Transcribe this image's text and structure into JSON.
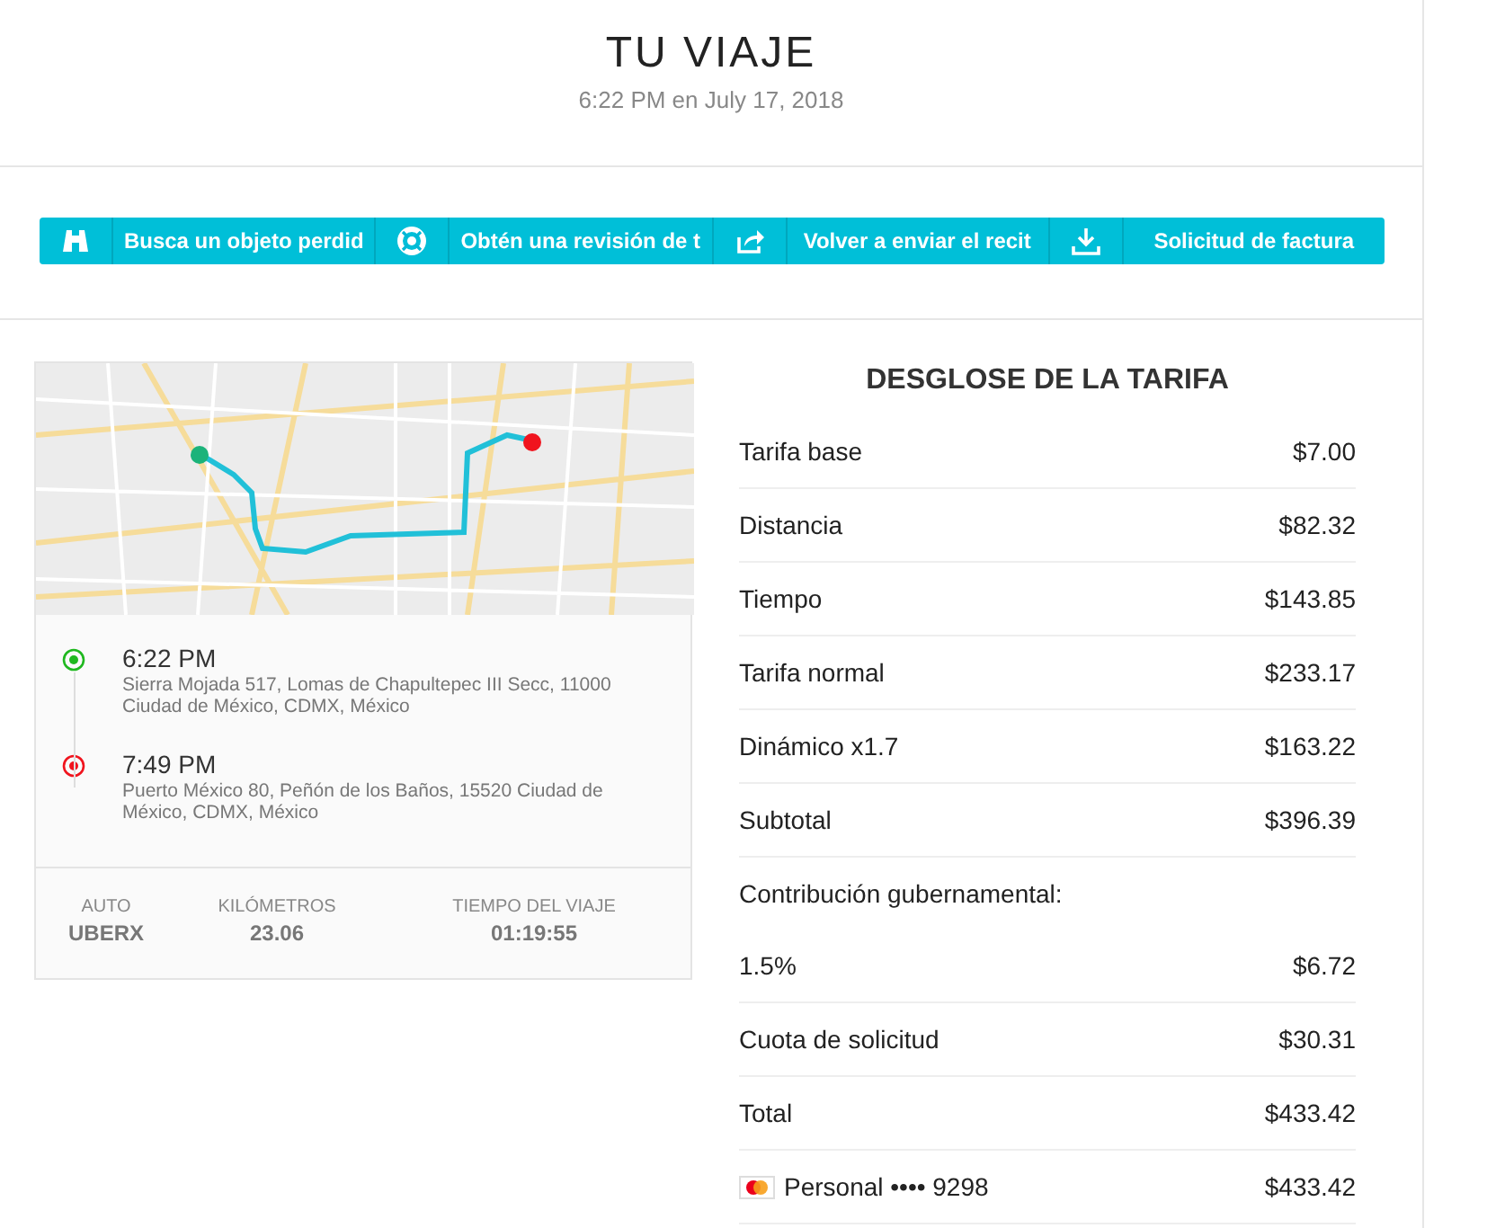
{
  "header": {
    "title": "TU VIAJE",
    "subtitle": "6:22 PM en July 17, 2018"
  },
  "actions": [
    {
      "kind": "binoculars",
      "label": "Busca un objeto perdid"
    },
    {
      "kind": "lifebuoy",
      "label": "Obtén una revisión de t"
    },
    {
      "kind": "share",
      "label": "Volver a enviar el recit"
    },
    {
      "kind": "download",
      "label": "Solicitud de factura"
    }
  ],
  "trip": {
    "stops": [
      {
        "color": "#1fb81f",
        "time": "6:22 PM",
        "address": "Sierra Mojada 517, Lomas de Chapultepec III Secc, 11000 Ciudad de México, CDMX, México"
      },
      {
        "color": "#f0141e",
        "time": "7:49 PM",
        "address": "Puerto México 80, Peñón de los Baños, 15520 Ciudad de México, CDMX, México"
      }
    ],
    "stats": [
      {
        "label": "AUTO",
        "value": "UBERX"
      },
      {
        "label": "KILÓMETROS",
        "value": "23.06"
      },
      {
        "label": "TIEMPO DEL VIAJE",
        "value": "01:19:55"
      }
    ]
  },
  "fare": {
    "title": "DESGLOSE DE LA TARIFA",
    "rows": [
      {
        "kind": "line",
        "label": "Tarifa base",
        "amount": "$7.00"
      },
      {
        "kind": "line",
        "label": "Distancia",
        "amount": "$82.32"
      },
      {
        "kind": "line",
        "label": "Tiempo",
        "amount": "$143.85"
      },
      {
        "kind": "line",
        "label": "Tarifa normal",
        "amount": "$233.17"
      },
      {
        "kind": "line",
        "label": "Dinámico x1.7",
        "amount": "$163.22"
      },
      {
        "kind": "line",
        "label": "Subtotal",
        "amount": "$396.39"
      },
      {
        "kind": "heading",
        "label": "Contribución gubernamental:"
      },
      {
        "kind": "line",
        "label": "1.5%",
        "amount": "$6.72"
      },
      {
        "kind": "line",
        "label": "Cuota de solicitud",
        "amount": "$30.31"
      },
      {
        "kind": "line",
        "label": "Total",
        "amount": "$433.42"
      },
      {
        "kind": "payment",
        "label": "Personal •••• 9298",
        "amount": "$433.42"
      }
    ]
  }
}
